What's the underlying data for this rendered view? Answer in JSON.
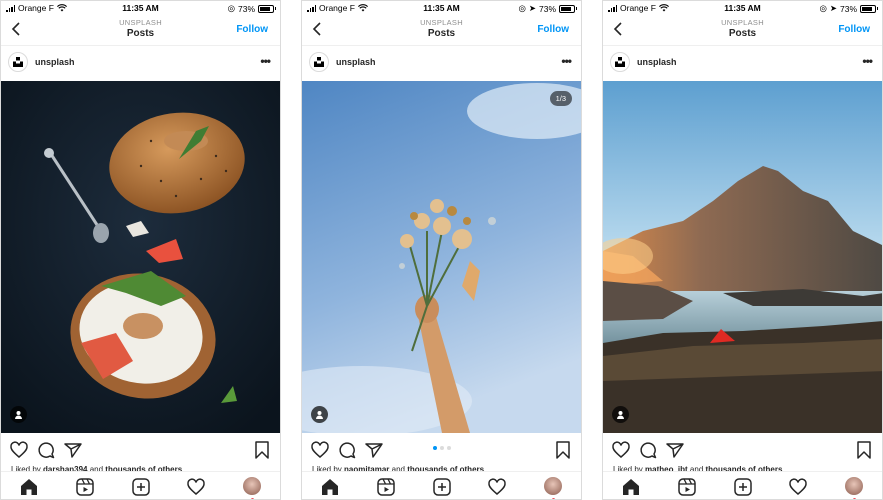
{
  "status": {
    "carrier": "Orange F",
    "time": "11:35 AM",
    "battery": "73%"
  },
  "header": {
    "subtitle": "UNSPLASH",
    "title": "Posts",
    "follow_label": "Follow"
  },
  "posts": [
    {
      "username": "unsplash",
      "counter": "",
      "liked_prefix": "Liked by ",
      "liked_user": "darshan394",
      "liked_mid": " and ",
      "liked_others": "thousands of others",
      "has_dots": false
    },
    {
      "username": "unsplash",
      "counter": "1/3",
      "liked_prefix": "Liked by ",
      "liked_user": "naomitamar",
      "liked_mid": " and ",
      "liked_others": "thousands of others",
      "has_dots": true,
      "dots_total": 3,
      "dots_active": 1
    },
    {
      "username": "unsplash",
      "counter": "",
      "liked_prefix": "Liked by ",
      "liked_user": "matheo_ibt",
      "liked_mid": " and ",
      "liked_others": "thousands of others",
      "has_dots": false
    }
  ],
  "icons": [
    "back-chevron-icon",
    "unsplash-logo-icon",
    "more-options-icon",
    "user-tag-icon",
    "heart-icon",
    "comment-icon",
    "share-icon",
    "bookmark-icon",
    "home-icon",
    "reels-icon",
    "new-post-icon",
    "activity-heart-icon",
    "profile-avatar"
  ],
  "colors": {
    "accent": "#0095f6",
    "notification": "#ed4956",
    "border": "#dbdbdb"
  }
}
